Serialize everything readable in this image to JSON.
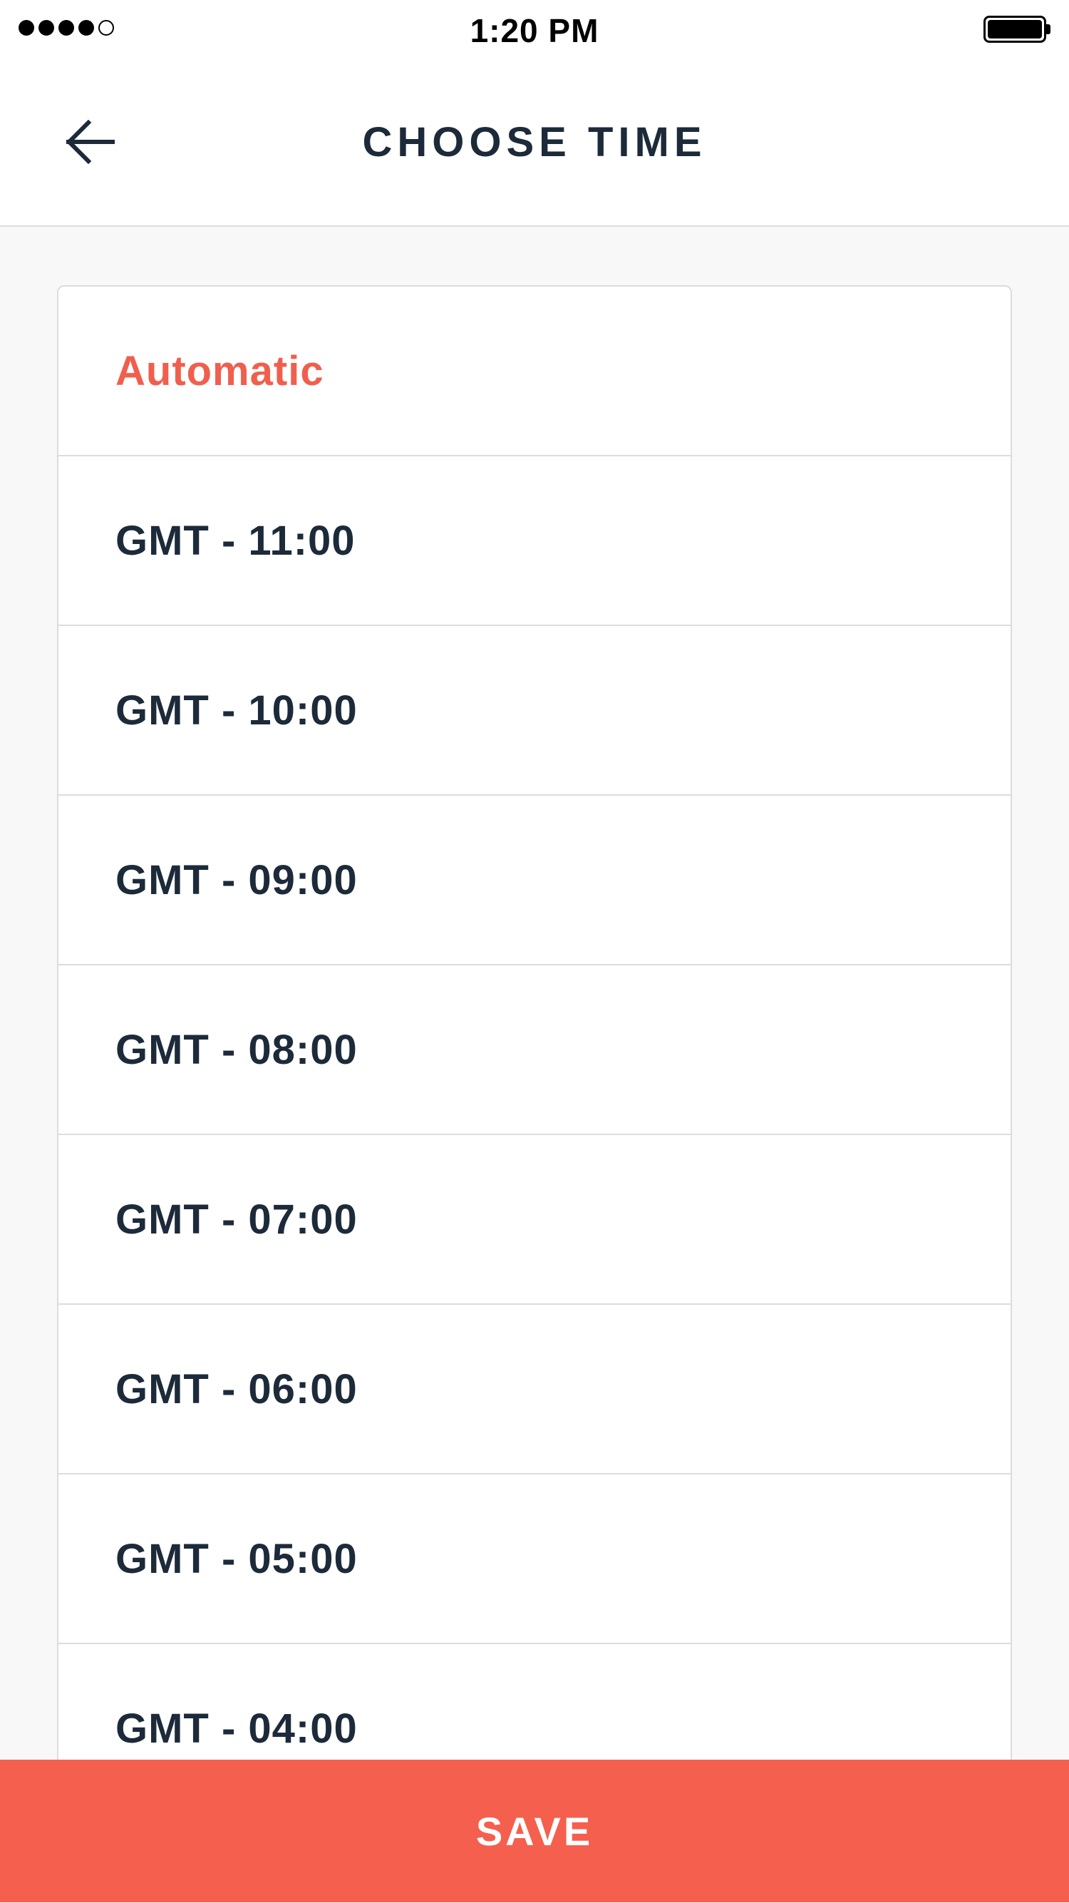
{
  "status_bar": {
    "signal_filled": 4,
    "signal_total": 5,
    "time": "1:20 PM",
    "battery_level": 1.0,
    "battery_icon": "battery-full-icon"
  },
  "header": {
    "back_icon": "arrow-left-icon",
    "title": "CHOOSE TIME"
  },
  "timezone_list": {
    "selected_index": 0,
    "options": [
      {
        "label": "Automatic"
      },
      {
        "label": "GMT - 11:00"
      },
      {
        "label": "GMT - 10:00"
      },
      {
        "label": "GMT - 09:00"
      },
      {
        "label": "GMT - 08:00"
      },
      {
        "label": "GMT - 07:00"
      },
      {
        "label": "GMT - 06:00"
      },
      {
        "label": "GMT - 05:00"
      },
      {
        "label": "GMT - 04:00"
      }
    ]
  },
  "footer": {
    "save_label": "SAVE"
  },
  "colors": {
    "accent": "#f55f4e",
    "selected_text": "#f05f4e",
    "text": "#1c2a3a",
    "background": "#f8f8f8",
    "divider": "#d9dde2"
  }
}
